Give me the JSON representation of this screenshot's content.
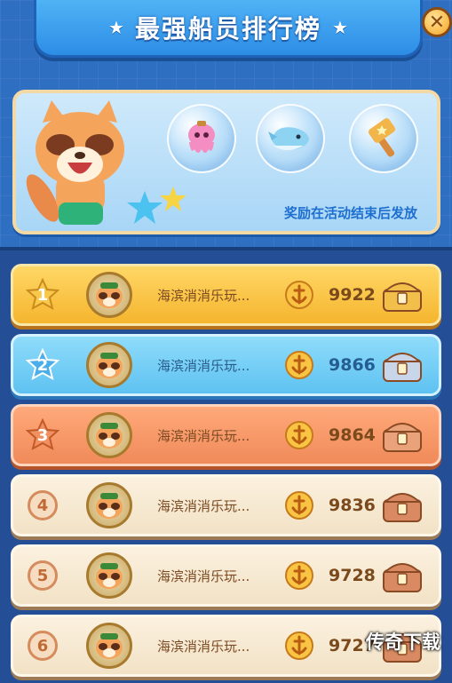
{
  "header": {
    "title": "最强船员排行榜"
  },
  "close_label": "✕",
  "reward_panel": {
    "note": "奖励在活动结束后发放",
    "rewards": [
      {
        "icon": "octopus-icon"
      },
      {
        "icon": "whale-icon"
      },
      {
        "icon": "hammer-icon"
      }
    ]
  },
  "leaderboard": {
    "rows": [
      {
        "rank": "1",
        "name": "海滨消消乐玩...",
        "score": "9922",
        "tier": "gold"
      },
      {
        "rank": "2",
        "name": "海滨消消乐玩...",
        "score": "9866",
        "tier": "silver"
      },
      {
        "rank": "3",
        "name": "海滨消消乐玩...",
        "score": "9864",
        "tier": "bronze"
      },
      {
        "rank": "4",
        "name": "海滨消消乐玩...",
        "score": "9836",
        "tier": "normal"
      },
      {
        "rank": "5",
        "name": "海滨消消乐玩...",
        "score": "9728",
        "tier": "normal"
      },
      {
        "rank": "6",
        "name": "海滨消消乐玩...",
        "score": "9727",
        "tier": "normal"
      }
    ]
  },
  "watermark": "传奇下载",
  "colors": {
    "background": "#2f6fc2",
    "gold": "#f5b52e",
    "silver": "#5ec2f1",
    "bronze": "#f08a5a",
    "normal": "#f2e2c6"
  }
}
